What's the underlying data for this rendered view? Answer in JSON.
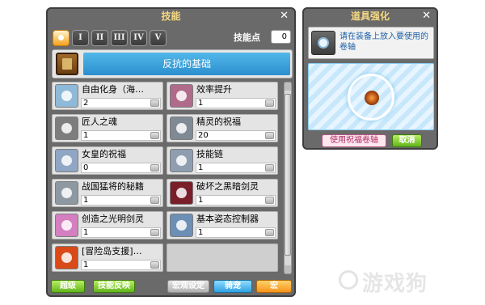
{
  "skill_window": {
    "title": "技能",
    "close_icon": "close-icon",
    "tabs": [
      {
        "label": "",
        "icon": "beginner-dot-icon",
        "active": true
      },
      {
        "label": "I",
        "active": false
      },
      {
        "label": "II",
        "active": false
      },
      {
        "label": "III",
        "active": false
      },
      {
        "label": "IV",
        "active": false
      },
      {
        "label": "V",
        "active": false
      }
    ],
    "skill_points_label": "技能点",
    "skill_points_value": "0",
    "job_name": "反抗的基础",
    "skills": [
      {
        "name": "自由化身（海…",
        "level": "2",
        "color": "#8fb9d8"
      },
      {
        "name": "效率提升",
        "level": "1",
        "color": "#b06a8a"
      },
      {
        "name": "匠人之魂",
        "level": "1",
        "color": "#7d7d7d"
      },
      {
        "name": "精灵的祝福",
        "level": "20",
        "color": "#7f8a95"
      },
      {
        "name": "女皇的祝福",
        "level": "0",
        "color": "#8fa6c4"
      },
      {
        "name": "技能链",
        "level": "1",
        "color": "#8e9eb0"
      },
      {
        "name": "战国猛将的秘籍",
        "level": "1",
        "color": "#8d98a3"
      },
      {
        "name": "破坏之黑暗剑灵",
        "level": "1",
        "color": "#7a1f2a"
      },
      {
        "name": "创造之光明剑灵",
        "level": "1",
        "color": "#d47fc0"
      },
      {
        "name": "基本姿态控制器",
        "level": "1",
        "color": "#6c8fb5"
      },
      {
        "name": "[冒险岛支援]…",
        "level": "1",
        "color": "#d84a18"
      }
    ],
    "bottom_buttons": {
      "advance": "超级",
      "skill_reset": "技能反映",
      "macro": "宏观设定",
      "mount": "骑宠",
      "macro2": "宏"
    }
  },
  "enhance_window": {
    "title": "道具强化",
    "instruction": "请在装备上放入要使用的卷轴",
    "use_scroll_button": "使用祝福卷轴",
    "cancel_button": "取消"
  },
  "watermark": "游戏狗"
}
